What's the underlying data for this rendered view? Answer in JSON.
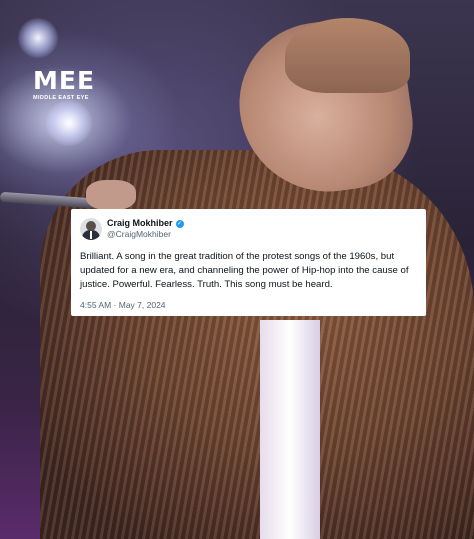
{
  "logo": {
    "mark": "MEE",
    "subtitle": "MIDDLE EAST EYE"
  },
  "tweet": {
    "author_name": "Craig Mokhiber",
    "handle": "@CraigMokhiber",
    "verified_icon": "verified-badge-icon",
    "text": "Brilliant. A song in the great tradition of the protest songs of the 1960s, but updated for a new era, and channeling the power of Hip-hop into the cause of justice. Powerful. Fearless. Truth. This song must be heard.",
    "timestamp": "4:55 AM · May 7, 2024"
  },
  "colors": {
    "verified_blue": "#1d9bf0",
    "muted_text": "#536471",
    "card_background": "#ffffff"
  }
}
